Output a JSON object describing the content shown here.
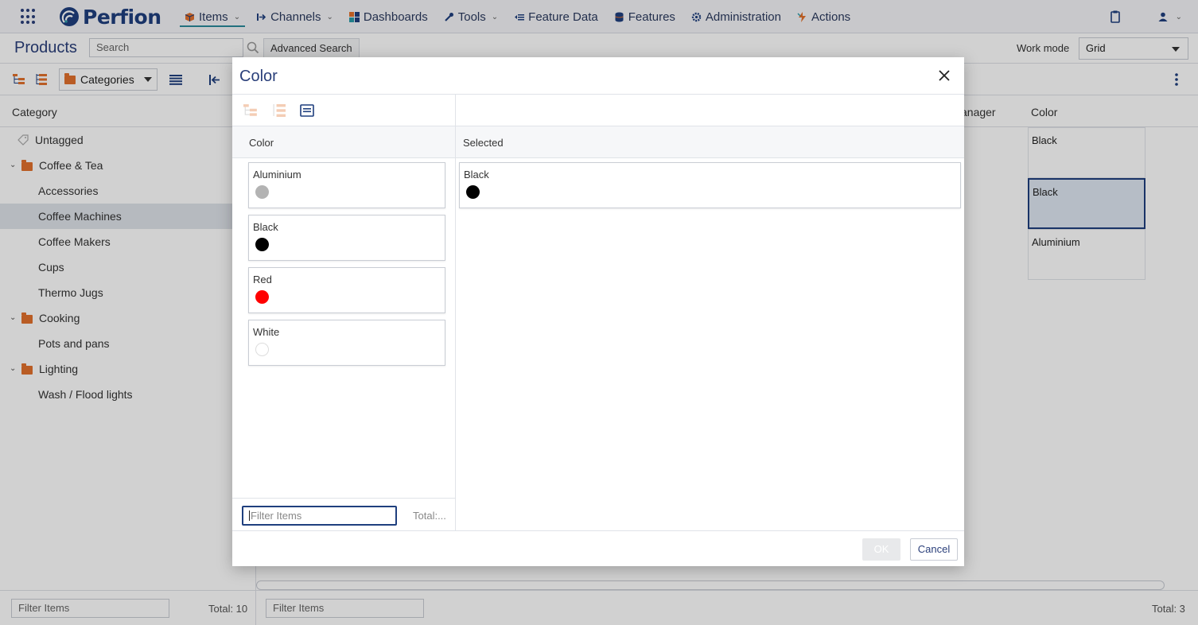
{
  "nav": {
    "logo": "Perfion",
    "items": [
      {
        "label": "Items",
        "icon": "cube-icon",
        "dropdown": true,
        "active": true
      },
      {
        "label": "Channels",
        "icon": "channel-arrow-icon",
        "dropdown": true
      },
      {
        "label": "Dashboards",
        "icon": "dashboard-grid-icon"
      },
      {
        "label": "Tools",
        "icon": "wrench-icon",
        "dropdown": true
      },
      {
        "label": "Feature Data",
        "icon": "list-arrow-icon"
      },
      {
        "label": "Features",
        "icon": "database-icon"
      },
      {
        "label": "Administration",
        "icon": "gear-icon"
      },
      {
        "label": "Actions",
        "icon": "lightning-icon"
      }
    ]
  },
  "app": {
    "title": "Products",
    "search_placeholder": "Search",
    "advanced_search": "Advanced Search",
    "work_mode_label": "Work mode",
    "work_mode_value": "Grid",
    "categories_label": "Categories",
    "category_header": "Category",
    "tree": [
      {
        "label": "Untagged",
        "level": 0,
        "type": "tag"
      },
      {
        "label": "Coffee & Tea",
        "level": 0,
        "type": "folder"
      },
      {
        "label": "Accessories",
        "level": 1
      },
      {
        "label": "Coffee Machines",
        "level": 1,
        "selected": true
      },
      {
        "label": "Coffee Makers",
        "level": 1
      },
      {
        "label": "Cups",
        "level": 1
      },
      {
        "label": "Thermo Jugs",
        "level": 1
      },
      {
        "label": "Cooking",
        "level": 0,
        "type": "folder"
      },
      {
        "label": "Pots and pans",
        "level": 1
      },
      {
        "label": "Lighting",
        "level": 0,
        "type": "folder"
      },
      {
        "label": "Wash / Flood lights",
        "level": 1
      }
    ],
    "left_filter_placeholder": "Filter Items",
    "left_total": "Total: 10",
    "grid_headers": {
      "manager": "anager",
      "color": "Color"
    },
    "grid_colors": [
      "Black",
      "Black",
      "Aluminium"
    ],
    "bottom_filter_placeholder": "Filter Items",
    "bottom_total": "Total: 3"
  },
  "dialog": {
    "title": "Color",
    "left_header": "Color",
    "right_header": "Selected",
    "items": [
      {
        "label": "Aluminium",
        "color": "#b3b3b3"
      },
      {
        "label": "Black",
        "color": "#000000"
      },
      {
        "label": "Red",
        "color": "#ff0000"
      },
      {
        "label": "White",
        "color": "#ffffff"
      }
    ],
    "selected": [
      {
        "label": "Black",
        "color": "#000000"
      }
    ],
    "filter_placeholder": "Filter Items",
    "total": "Total:...",
    "ok_label": "OK",
    "cancel_label": "Cancel"
  }
}
